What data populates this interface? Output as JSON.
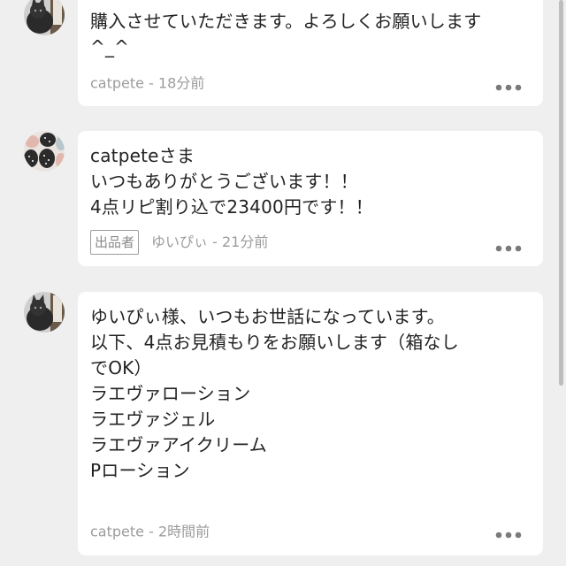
{
  "comments": [
    {
      "message": "購入させていただきます。よろしくお願いします\n^_^",
      "author": "catpete",
      "separator": " - ",
      "time": "18分前",
      "avatar_icon": "cat-avatar-icon"
    },
    {
      "message": "catpeteさま\nいつもありがとうございます！！\n4点リピ割り込で23400円です！！",
      "badge": "出品者",
      "author": "ゆいぴぃ",
      "separator": " - ",
      "time": "21分前",
      "avatar_icon": "pattern-avatar-icon"
    },
    {
      "message": "ゆいぴぃ様、いつもお世話になっています。\n以下、4点お見積もりをお願いします（箱なし\nでOK）\nラエヴァローション\nラエヴァジェル\nラエヴァアイクリーム\nPローション",
      "author": "catpete",
      "separator": " - ",
      "time": "2時間前",
      "avatar_icon": "cat-avatar-icon"
    }
  ],
  "more_icon": "more-dots-icon",
  "colors": {
    "background": "#efefef",
    "card": "#ffffff",
    "text": "#222222",
    "meta": "#9c9c9c"
  }
}
